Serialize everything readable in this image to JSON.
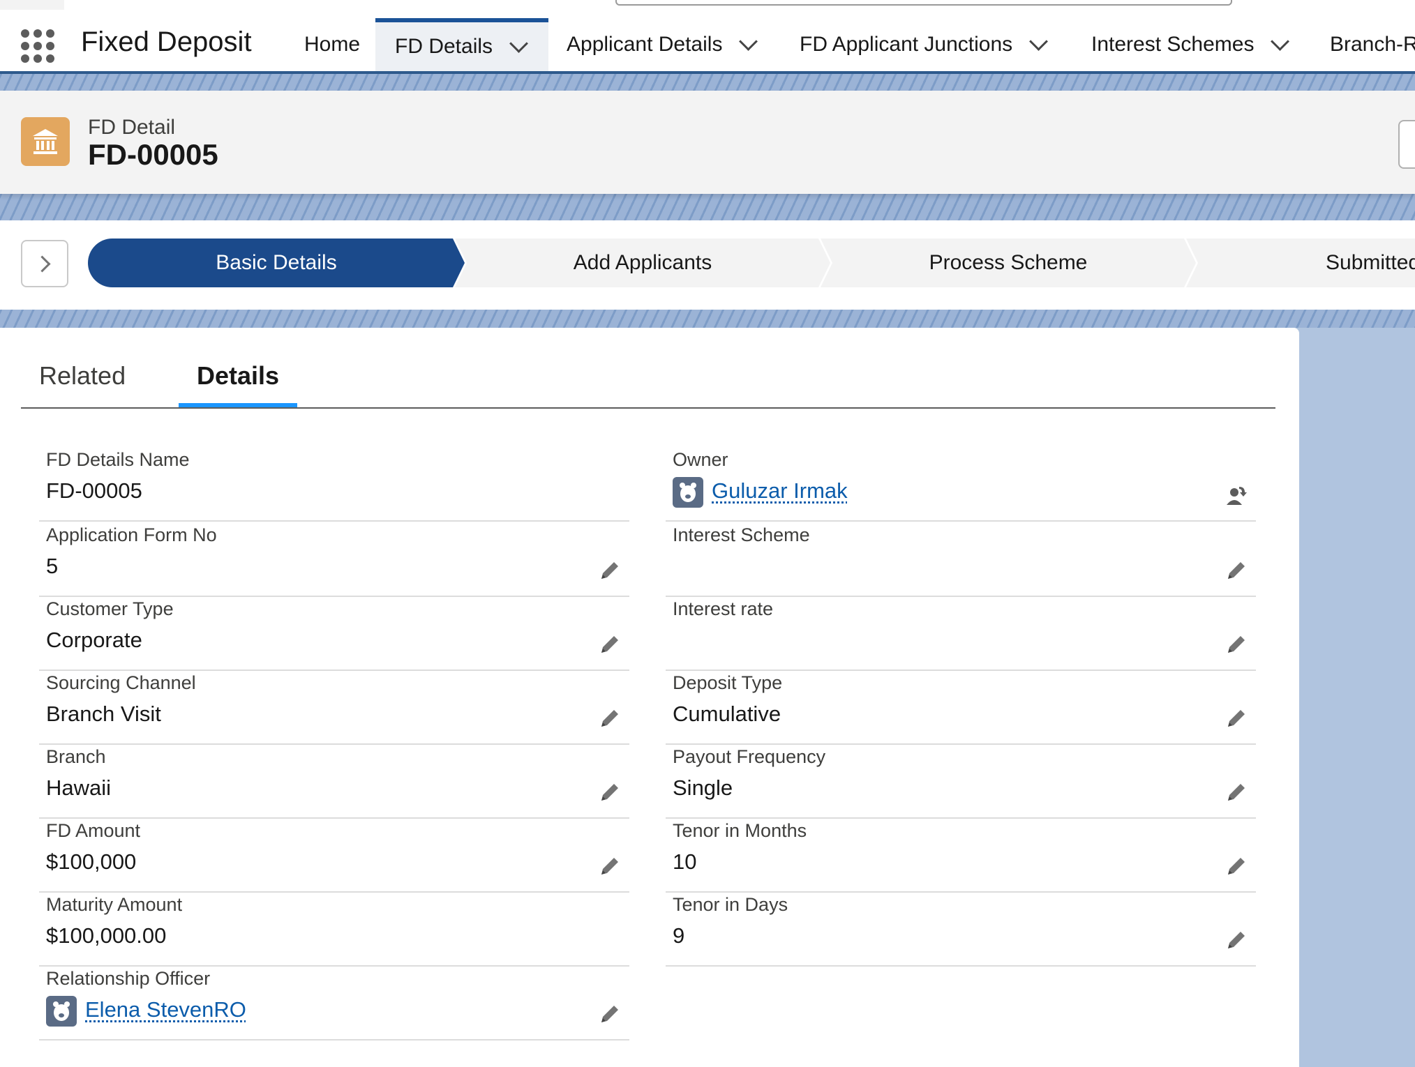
{
  "app": {
    "name": "Fixed Deposit"
  },
  "nav": {
    "tabs": [
      {
        "label": "Home"
      },
      {
        "label": "FD Details"
      },
      {
        "label": "Applicant Details"
      },
      {
        "label": "FD Applicant Junctions"
      },
      {
        "label": "Interest Schemes"
      },
      {
        "label": "Branch-R"
      }
    ]
  },
  "record": {
    "type": "FD Detail",
    "title": "FD-00005",
    "icon": "bank-icon",
    "icon_color": "#e3a75f"
  },
  "path": {
    "stages": [
      {
        "label": "Basic Details",
        "status": "current"
      },
      {
        "label": "Add Applicants",
        "status": "todo"
      },
      {
        "label": "Process Scheme",
        "status": "todo"
      },
      {
        "label": "Submitted",
        "status": "todo"
      }
    ],
    "current_color": "#1b4a8b"
  },
  "detail_tabs": [
    {
      "label": "Related"
    },
    {
      "label": "Details"
    }
  ],
  "left_fields": [
    {
      "label": "FD Details Name",
      "value": "FD-00005"
    },
    {
      "label": "Application Form No",
      "value": "5"
    },
    {
      "label": "Customer Type",
      "value": "Corporate"
    },
    {
      "label": "Sourcing Channel",
      "value": "Branch Visit"
    },
    {
      "label": "Branch",
      "value": "Hawaii"
    },
    {
      "label": "FD Amount",
      "value": "$100,000"
    },
    {
      "label": "Maturity Amount",
      "value": "$100,000.00"
    },
    {
      "label": "Relationship Officer",
      "value": "Elena StevenRO"
    }
  ],
  "right_fields": [
    {
      "label": "Owner",
      "value": "Guluzar Irmak"
    },
    {
      "label": "Interest Scheme",
      "value": ""
    },
    {
      "label": "Interest rate",
      "value": ""
    },
    {
      "label": "Deposit Type",
      "value": "Cumulative"
    },
    {
      "label": "Payout Frequency",
      "value": "Single"
    },
    {
      "label": "Tenor in Months",
      "value": "10"
    },
    {
      "label": "Tenor in Days",
      "value": "9"
    }
  ],
  "colors": {
    "link": "#0b5cab",
    "tab_underline": "#1b96ff",
    "nav_active_border": "#1b5297"
  }
}
